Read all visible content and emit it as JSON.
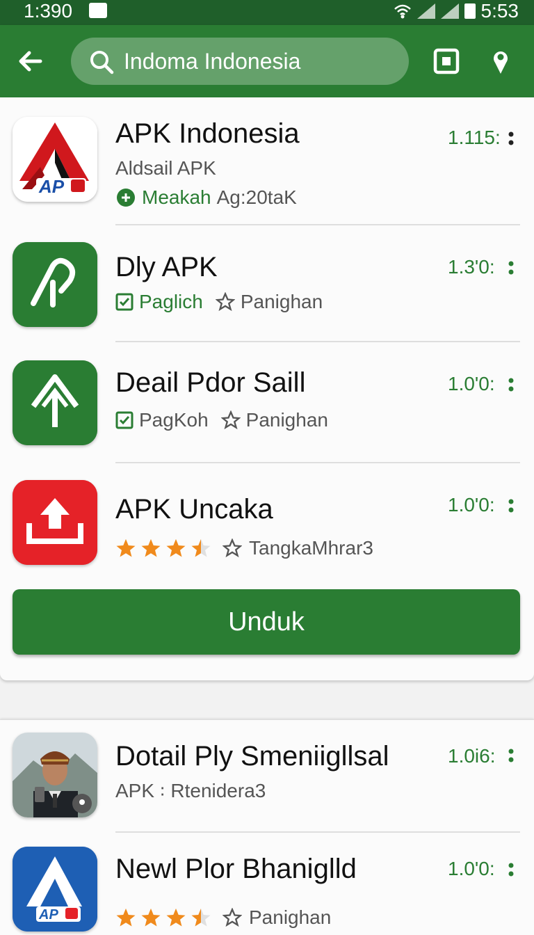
{
  "status_bar": {
    "time_left": "1:390",
    "time_right": "5:53"
  },
  "search": {
    "value": "Indoma Indonesia"
  },
  "icons": {
    "back": "arrow-left-icon",
    "search": "search-icon",
    "scan": "scan-square-icon",
    "location": "location-pin-icon",
    "more": "more-vertical-icon"
  },
  "colors": {
    "primary": "#2a7d33",
    "status_bar": "#1f5f2a",
    "star": "#f08a1c",
    "red_icon": "#e52228",
    "blue_icon": "#1e5fb4"
  },
  "list": [
    {
      "title": "APK Indonesia",
      "subtitle": "Aldsail APK",
      "badge": "Meakah",
      "badge_extra": "Ag:20taK",
      "version": "1.115:"
    },
    {
      "title": "Dly APK",
      "tag": "Paglich",
      "tag2": "Panighan",
      "version": "1.3'0:"
    },
    {
      "title": "Deail Pdor Saill",
      "tag": "PagKoh",
      "tag2": "Panighan",
      "version": "1.0'0:"
    },
    {
      "title": "APK Uncaka",
      "rating": 3.5,
      "tag2": "TangkaMhrar3",
      "version": "1.0'0:"
    }
  ],
  "download_button": "Unduk",
  "list2": [
    {
      "title": "Dotail Ply Smeniigllsal",
      "subtitle": "APK ꞉ Rtenidera3",
      "version": "1.0i6:"
    },
    {
      "title": "Newl Plor Bhaniglld",
      "rating": 3.5,
      "tag2": "Panighan",
      "version": "1.0'0:"
    }
  ]
}
